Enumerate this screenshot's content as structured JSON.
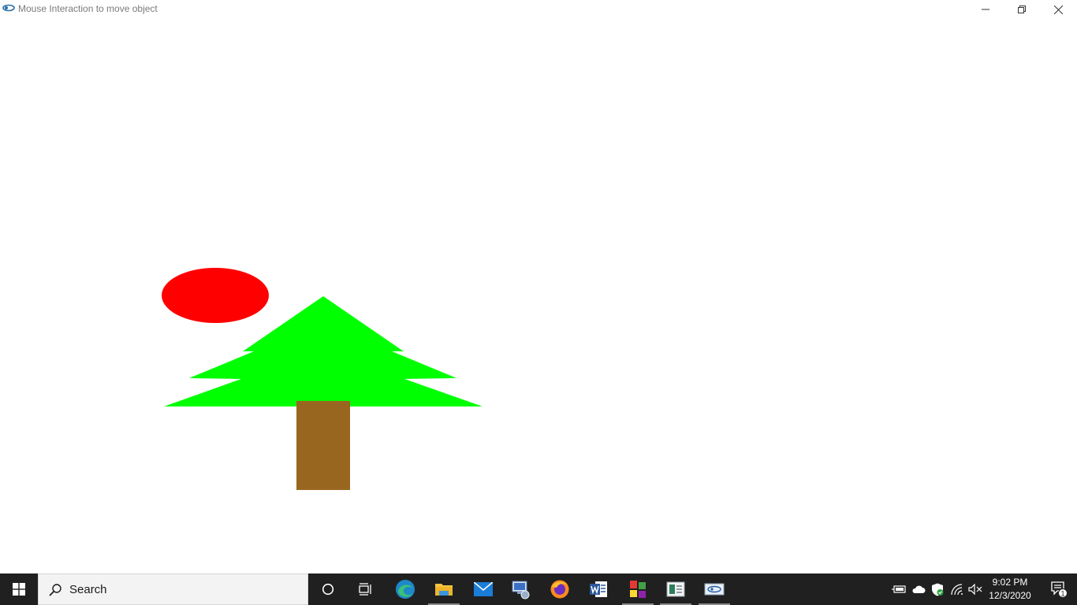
{
  "window": {
    "title": "Mouse Interaction to move object",
    "buttons": {
      "minimize": "minimize",
      "restore": "restore",
      "close": "close"
    }
  },
  "scene": {
    "background_color": "#ffffff",
    "ellipse_color": "#ff0000",
    "tree_color": "#00ff00",
    "trunk_color": "#996620"
  },
  "taskbar": {
    "search_placeholder": "Search",
    "pinned_apps": [
      "cortana-icon",
      "task-view-icon",
      "edge-icon",
      "file-explorer-icon",
      "mail-icon",
      "network-app-icon",
      "firefox-icon",
      "word-icon",
      "colored-app-icon",
      "reader-app-icon",
      "running-app-icon"
    ],
    "time": "9:02 PM",
    "date": "12/3/2020",
    "notification_count": "1"
  }
}
